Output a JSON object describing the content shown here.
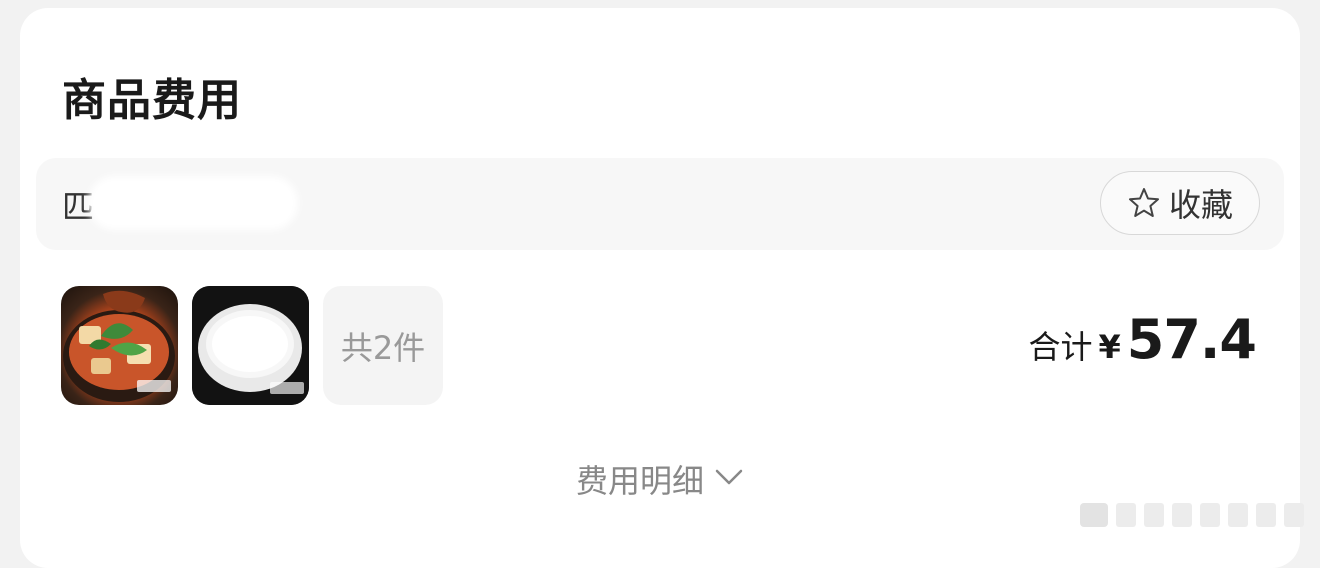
{
  "section": {
    "title": "商品费用"
  },
  "store": {
    "name": "匹",
    "favorite_label": "收藏",
    "favorite_icon": "star-outline-icon"
  },
  "items": {
    "thumbnails": [
      {
        "name": "mapo-tofu-claypot-dish",
        "watermark": "美团"
      },
      {
        "name": "bowl-of-rice",
        "watermark": "美团"
      }
    ],
    "count_label": "共2件"
  },
  "total": {
    "label": "合计",
    "currency": "¥",
    "amount": "57.4"
  },
  "detail": {
    "label": "费用明细",
    "icon": "chevron-down-icon"
  },
  "colors": {
    "background": "#f2f2f2",
    "card": "#ffffff",
    "store_row": "#f7f7f7",
    "muted_text": "#999999"
  }
}
